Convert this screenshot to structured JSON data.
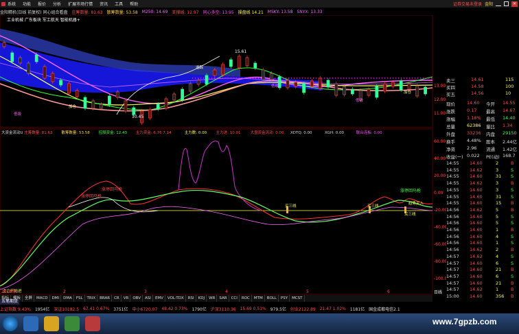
{
  "menubar": {
    "items": [
      "系统",
      "功能",
      "报价",
      "分析",
      "扩展市场行情",
      "资讯",
      "工具",
      "帮助"
    ],
    "right_text": "证券交易未登录",
    "right_extra": "金阳"
  },
  "top_info": {
    "title": "金阳精机(日线 前复权) 同心组合看盘",
    "items": [
      {
        "label": "庄筹数量: 81.63",
        "color": "#ff4d4d"
      },
      {
        "label": "散筹数量: 53.58",
        "color": "#ffd54d"
      },
      {
        "label": "M250: 14.69",
        "color": "#ff66ff"
      },
      {
        "label": "支撑线: 12.97",
        "color": "#ff4d4d"
      },
      {
        "label": "同心多空: 13.95",
        "color": "#ff4dff"
      },
      {
        "label": "操盘线 14.21",
        "color": "#ffff4d"
      },
      {
        "label": "MSKY: 13.58",
        "color": "#ff66ff"
      },
      {
        "label": "SNYX: 13.33",
        "color": "#ff66ff"
      }
    ]
  },
  "sector_line": "工业机械 广东板块 军工航天 智能机器+",
  "main_chart": {
    "y_ticks": [
      "13.00",
      "12.00",
      "11.00"
    ],
    "annotations": [
      {
        "text": "15.61",
        "color": "#fff"
      },
      {
        "text": "10.45",
        "color": "#fff"
      },
      {
        "text": "追踪",
        "color": "#ff9"
      },
      {
        "text": "低吸",
        "color": "#f6f"
      },
      {
        "text": "低吸",
        "color": "#f6f"
      },
      {
        "text": "低吸",
        "color": "#f6f"
      },
      {
        "text": "加仓",
        "color": "#ff9"
      },
      {
        "text": "加仓",
        "color": "#ff9"
      }
    ]
  },
  "indicator_header": {
    "items": [
      {
        "label": "大资金流动U",
        "color": "#ddd"
      },
      {
        "label": "庄筹数量: 81.63",
        "color": "#ff4d4d"
      },
      {
        "label": "散筹数量: 53.58",
        "color": "#ffd54d"
      },
      {
        "label": "控股资金: 12.43",
        "color": "#4dff4d"
      },
      {
        "label": "主力资金: 6.76 7.14",
        "color": "#ff4d4d"
      },
      {
        "label": "主力数: 0.00",
        "color": "#ffff4d"
      },
      {
        "label": "主力进: 10.01",
        "color": "#ff4d4d"
      },
      {
        "label": "大盘资金流动: 0.00",
        "color": "#ff4d4d"
      },
      {
        "label": "XDTQ: 0.00",
        "color": "#ddd"
      },
      {
        "label": "XGH: 0.00",
        "color": "#ddd"
      },
      {
        "label": "联合连板: 0.00",
        "color": "#ff4dff"
      }
    ],
    "y_ticks": [
      "60.00",
      "40.00",
      "20.00",
      "0.00",
      "-20.00",
      "-40.00",
      "-60.00",
      "-80.00",
      "-100.00"
    ],
    "annotations": [
      {
        "text": "涨停回马枪",
        "color": "#ff4d4d"
      },
      {
        "text": "涨停回马枪",
        "color": "#ff4d4d"
      },
      {
        "text": "涨停回马枪",
        "color": "#4dff4d"
      },
      {
        "text": "买三线",
        "color": "#ffff4d"
      },
      {
        "text": "买三线",
        "color": "#ffff4d"
      },
      {
        "text": "趋势买入",
        "color": "#ffff4d"
      },
      {
        "text": "买三线",
        "color": "#ffff4d"
      },
      {
        "text": "主力开始进",
        "color": "#ffff4d"
      }
    ]
  },
  "x_axis": {
    "labels": [
      "2016年",
      "2",
      "3",
      "4",
      "5",
      "6"
    ]
  },
  "bottom_tabs": [
    "指标",
    "模板",
    "全屏",
    "MACD",
    "DMI",
    "DMA",
    "FSL",
    "TRIX",
    "BRAR",
    "CR",
    "VR",
    "OBV",
    "ASI",
    "EMV",
    "VOL-TDX",
    "RSI",
    "KDJ",
    "WR",
    "SAR",
    "CCI",
    "ROC",
    "MTM",
    "BOLL",
    "PSY",
    "MCST"
  ],
  "bottom_tab_left": "五笔期货",
  "bottom_corner": "日线",
  "right_panel": {
    "quotes": [
      {
        "label": "卖三",
        "price": "14.61",
        "vol": "115"
      },
      {
        "label": "买四",
        "price": "14.58",
        "vol": "100"
      },
      {
        "label": "买五",
        "price": "14.56",
        "vol": "10"
      }
    ],
    "stats_left": [
      {
        "label": "现价",
        "value": "14.60",
        "color": "#ff4d4d"
      },
      {
        "label": "涨跌",
        "value": "0.17",
        "color": "#ff4d4d"
      },
      {
        "label": "涨幅",
        "value": "1.18%",
        "color": "#ff4d4d"
      },
      {
        "label": "总量",
        "value": "62386",
        "color": "#ffff4d"
      },
      {
        "label": "外盘",
        "value": "33236",
        "color": "#ff4d4d"
      },
      {
        "label": "换手",
        "value": "4.48%",
        "color": "#ddd"
      },
      {
        "label": "净资",
        "value": "2.96",
        "color": "#ddd"
      },
      {
        "label": "收益(一)",
        "value": "0.022",
        "color": "#ddd"
      }
    ],
    "stats_right": [
      {
        "label": "今开",
        "value": "14.55",
        "color": "#ff4d4d"
      },
      {
        "label": "最高",
        "value": "14.67",
        "color": "#ff4d4d"
      },
      {
        "label": "最低",
        "value": "14.40",
        "color": "#4dff4d"
      },
      {
        "label": "量比",
        "value": "1.34",
        "color": "#ff4d4d"
      },
      {
        "label": "内盘",
        "value": "29150",
        "color": "#4dff4d"
      },
      {
        "label": "股本",
        "value": "2.44亿",
        "color": "#ddd"
      },
      {
        "label": "流通",
        "value": "1.42亿",
        "color": "#ddd"
      },
      {
        "label": "PE(动)",
        "value": "168.7",
        "color": "#ddd"
      }
    ],
    "ticks": [
      {
        "time": "14:55",
        "price": "14.60",
        "vol": "2",
        "flag": "B"
      },
      {
        "time": "14:55",
        "price": "14.62",
        "vol": "3",
        "flag": "S"
      },
      {
        "time": "14:55",
        "price": "14.60",
        "vol": "31",
        "flag": "S"
      },
      {
        "time": "14:55",
        "price": "14.62",
        "vol": "3",
        "flag": "B"
      },
      {
        "time": "14:55",
        "price": "14.60",
        "vol": "3",
        "flag": "S"
      },
      {
        "time": "14:55",
        "price": "14.60",
        "vol": "31",
        "flag": "S"
      },
      {
        "time": "14:55",
        "price": "14.60",
        "vol": "15",
        "flag": "B"
      },
      {
        "time": "14:56",
        "price": "14.62",
        "vol": "5",
        "flag": "B"
      },
      {
        "time": "14:56",
        "price": "14.60",
        "vol": "5",
        "flag": "S"
      },
      {
        "time": "14:56",
        "price": "14.60",
        "vol": "5",
        "flag": "S"
      },
      {
        "time": "14:56",
        "price": "14.60",
        "vol": "1",
        "flag": "B"
      },
      {
        "time": "14:56",
        "price": "14.60",
        "vol": "4",
        "flag": "S"
      },
      {
        "time": "14:56",
        "price": "14.60",
        "vol": "1",
        "flag": "S"
      },
      {
        "time": "14:56",
        "price": "14.62",
        "vol": "2",
        "flag": "B"
      },
      {
        "time": "14:57",
        "price": "14.62",
        "vol": "4",
        "flag": "S"
      },
      {
        "time": "14:57",
        "price": "14.60",
        "vol": "6",
        "flag": "S"
      },
      {
        "time": "14:57",
        "price": "14.60",
        "vol": "21",
        "flag": "B"
      },
      {
        "time": "14:57",
        "price": "14.60",
        "vol": "6",
        "flag": "S"
      },
      {
        "time": "14:57",
        "price": "14.60",
        "vol": "21",
        "flag": "B"
      },
      {
        "time": "14:57",
        "price": "14.62",
        "vol": "1",
        "flag": "B"
      },
      {
        "time": "15:00",
        "price": "14.60",
        "vol": "356",
        "flag": "B"
      }
    ]
  },
  "status_bar": [
    {
      "text": "上证指数 9.43%",
      "color": "#ff4d4d"
    },
    {
      "text": "1954亿",
      "color": "#ddd"
    },
    {
      "text": "深证10182.5",
      "color": "#ff4d4d"
    },
    {
      "text": "67.41 0.67%",
      "color": "#ff4d4d"
    },
    {
      "text": "3751亿",
      "color": "#ddd"
    },
    {
      "text": "中小6720.07",
      "color": "#ff4d4d"
    },
    {
      "text": "48.42 0.73%",
      "color": "#ff4d4d"
    },
    {
      "text": "1790亿",
      "color": "#ddd"
    },
    {
      "text": "沪深3110.36",
      "color": "#ff4d4d"
    },
    {
      "text": "15.69 0.51%",
      "color": "#ff4d4d"
    },
    {
      "text": "979.5亿",
      "color": "#ddd"
    },
    {
      "text": "创业2122.89",
      "color": "#ff4d4d"
    },
    {
      "text": "21.47 1.02%",
      "color": "#ff4d4d"
    },
    {
      "text": "1181亿",
      "color": "#ddd"
    },
    {
      "text": "国金成都电信2.1",
      "color": "#ddd"
    }
  ],
  "watermark": "www.7gpzb.com",
  "colors": {
    "up": "#ff4d4d",
    "down": "#4dff4d",
    "yellow": "#ffff4d",
    "magenta": "#ff4dff",
    "blue_band": "#1a1aff"
  }
}
